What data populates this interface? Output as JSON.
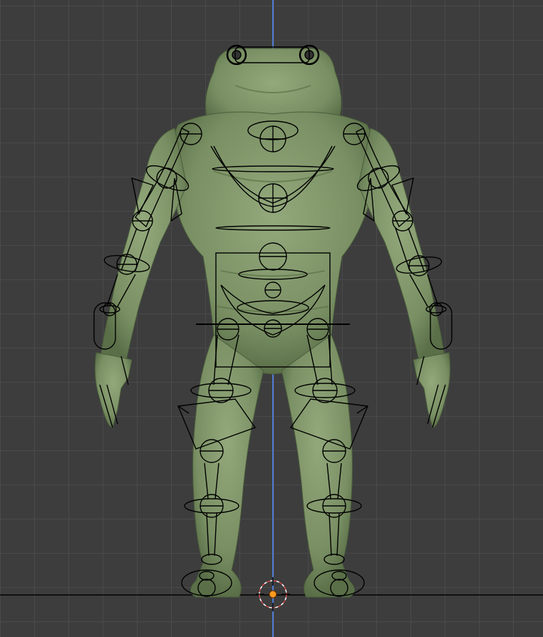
{
  "viewport": {
    "background_color": "#3d3d3d",
    "grid_color": "#4a4a4a",
    "axis_z_color": "#4f7bd1",
    "floor_line_color": "#111111",
    "model_color": "#7e9468",
    "model_shadow_color": "#4f6440",
    "armature_color": "#000000",
    "cursor_color": "#ff9a1f"
  },
  "scene_objects": [
    {
      "name": "frog-character-mesh",
      "kind": "mesh"
    },
    {
      "name": "armature-rig",
      "kind": "armature"
    },
    {
      "name": "3d-cursor",
      "kind": "cursor"
    }
  ]
}
